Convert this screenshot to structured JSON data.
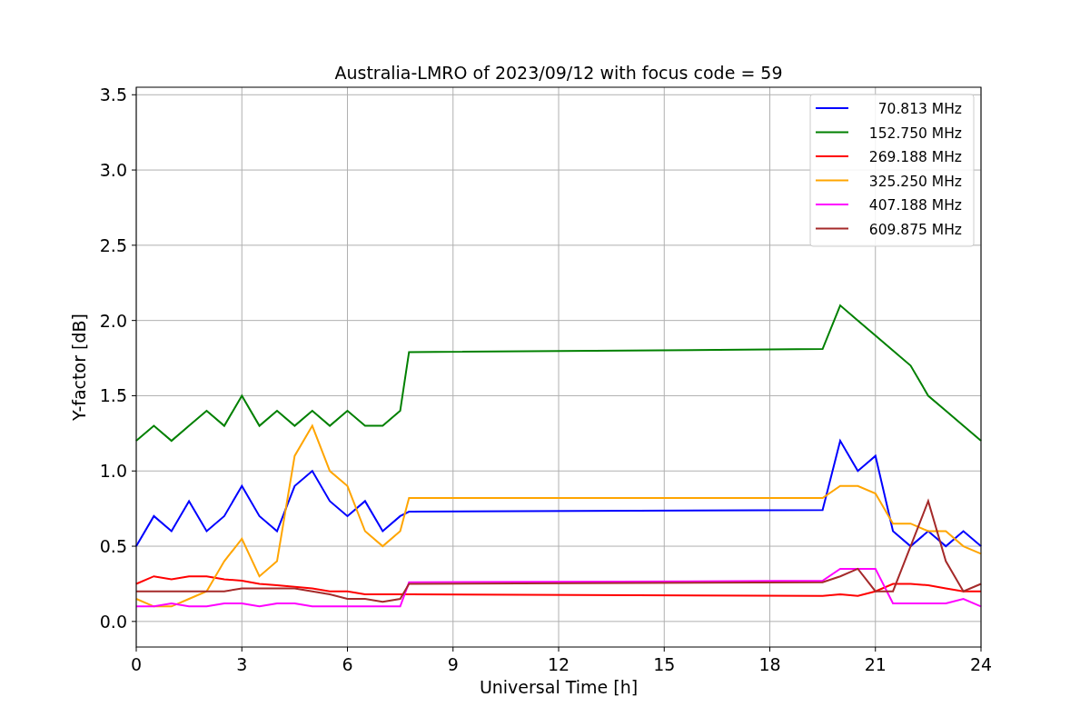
{
  "figure": {
    "chart_data": {
      "type": "line",
      "title": "Australia-LMRO of 2023/09/12 with focus code = 59",
      "xlabel": "Universal Time [h]",
      "ylabel": "Y-factor [dB]",
      "x": [
        0,
        0.5,
        1,
        1.5,
        2,
        2.5,
        3,
        3.5,
        4,
        4.5,
        5,
        5.5,
        6,
        6.5,
        7,
        7.5,
        7.75,
        19.5,
        20,
        20.5,
        21,
        21.5,
        22,
        22.5,
        23,
        23.5,
        24
      ],
      "xlim": [
        0,
        24
      ],
      "ylim": [
        -0.17,
        3.55
      ],
      "xticks": [
        0,
        3,
        6,
        9,
        12,
        15,
        18,
        21,
        24
      ],
      "grid": true,
      "legend": true,
      "yticks": [
        {
          "value": 0,
          "label": "0.0"
        },
        {
          "value": 0.5,
          "label": "0.5"
        },
        {
          "value": 1,
          "label": "1.0"
        },
        {
          "value": 1.5,
          "label": "1.5"
        },
        {
          "value": 2,
          "label": "2.0"
        },
        {
          "value": 2.5,
          "label": "2.5"
        },
        {
          "value": 3,
          "label": "3.0"
        },
        {
          "value": 3.5,
          "label": "3.5"
        }
      ],
      "series": [
        {
          "name": "70.813 MHz",
          "color": "#0000ff",
          "values": [
            0.5,
            0.7,
            0.6,
            0.8,
            0.6,
            0.7,
            0.9,
            0.7,
            0.6,
            0.9,
            1.0,
            0.8,
            0.7,
            0.8,
            0.6,
            0.7,
            0.73,
            0.74,
            1.2,
            1.0,
            1.1,
            0.6,
            0.5,
            0.6,
            0.5,
            0.6,
            0.5
          ]
        },
        {
          "name": "152.750 MHz",
          "color": "#008000",
          "values": [
            1.2,
            1.3,
            1.2,
            1.3,
            1.4,
            1.3,
            1.5,
            1.3,
            1.4,
            1.3,
            1.4,
            1.3,
            1.4,
            1.3,
            1.3,
            1.4,
            1.79,
            1.81,
            2.1,
            2.0,
            1.9,
            1.8,
            1.7,
            1.5,
            1.4,
            1.3,
            1.2
          ]
        },
        {
          "name": "269.188 MHz",
          "color": "#ff0000",
          "values": [
            0.25,
            0.3,
            0.28,
            0.3,
            0.3,
            0.28,
            0.27,
            0.25,
            0.24,
            0.23,
            0.22,
            0.2,
            0.2,
            0.18,
            0.18,
            0.18,
            0.18,
            0.17,
            0.18,
            0.17,
            0.2,
            0.25,
            0.25,
            0.24,
            0.22,
            0.2,
            0.2
          ]
        },
        {
          "name": "325.250 MHz",
          "color": "#ffa500",
          "values": [
            0.15,
            0.1,
            0.1,
            0.15,
            0.2,
            0.4,
            0.55,
            0.3,
            0.4,
            1.1,
            1.3,
            1.0,
            0.9,
            0.6,
            0.5,
            0.6,
            0.82,
            0.82,
            0.9,
            0.9,
            0.85,
            0.65,
            0.65,
            0.6,
            0.6,
            0.5,
            0.45
          ]
        },
        {
          "name": "407.188 MHz",
          "color": "#ff00ff",
          "values": [
            0.1,
            0.1,
            0.12,
            0.1,
            0.1,
            0.12,
            0.12,
            0.1,
            0.12,
            0.12,
            0.1,
            0.1,
            0.1,
            0.1,
            0.1,
            0.1,
            0.26,
            0.27,
            0.35,
            0.35,
            0.35,
            0.12,
            0.12,
            0.12,
            0.12,
            0.15,
            0.1
          ]
        },
        {
          "name": "609.875 MHz",
          "color": "#a52a2a",
          "values": [
            0.2,
            0.2,
            0.2,
            0.2,
            0.2,
            0.2,
            0.22,
            0.22,
            0.22,
            0.22,
            0.2,
            0.18,
            0.15,
            0.15,
            0.13,
            0.15,
            0.25,
            0.26,
            0.3,
            0.35,
            0.2,
            0.2,
            0.5,
            0.8,
            0.4,
            0.2,
            0.25
          ]
        }
      ]
    }
  }
}
